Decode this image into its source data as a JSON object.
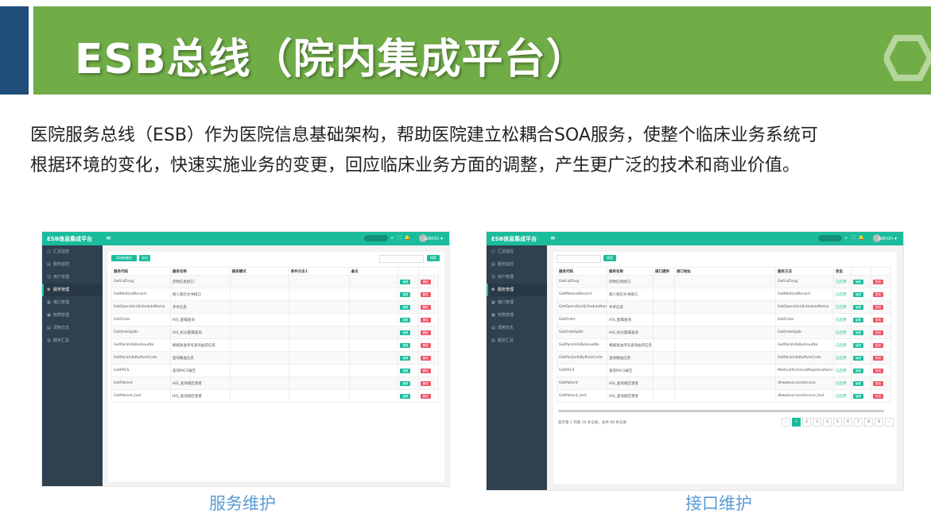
{
  "slide": {
    "title": "ESB总线（院内集成平台）",
    "intro_line1": "医院服务总线（ESB）作为医院信息基础架构，帮助医院建立松耦合SOA服务，使整个临床业务系统可",
    "intro_line2": "根据环境的变化，快速实施业务的变更，回应临床业务方面的调整，产生更广泛的技术和商业价值。",
    "caption_left": "服务维护",
    "caption_right": "接口维护",
    "colors": {
      "banner": "#70ad47",
      "tab": "#1f4e79",
      "caption": "#5b9bd5",
      "app_accent": "#1abc9c",
      "app_sidebar": "#2f4050",
      "delete": "#ed5565"
    }
  },
  "app": {
    "brand": "ESB信息集成平台",
    "menu_icon": "≡",
    "user": "admin",
    "sidebar": [
      "汇总监控",
      "服务监控",
      "用户管理",
      "服务管理",
      "接口管理",
      "权限管理",
      "调用日志",
      "服务汇总"
    ],
    "sidebar_icons": [
      "dashboard-icon",
      "monitor-icon",
      "user-icon",
      "gear-icon",
      "interface-icon",
      "permission-icon",
      "log-icon",
      "summary-icon"
    ]
  },
  "service": {
    "add_btn": "添加新服务",
    "export_btn": "导出",
    "search_btn": "搜索",
    "columns": [
      "服务代码",
      "服务名称",
      "服务模式",
      "条件分支1",
      "备注"
    ],
    "edit": "编辑",
    "delete": "删除",
    "rows": [
      [
        "GetLisDrug",
        "药物信息接口"
      ],
      [
        "GetMedicalRecord",
        "病人病历文书接口"
      ],
      [
        "GetOperationScheduleName",
        "手术信息"
      ],
      [
        "GetOrder",
        "HIS_医嘱查询"
      ],
      [
        "GetOrdeSplitr",
        "HIS_拆分医嘱查询"
      ],
      [
        "GetPackInfoByIssueNo",
        "根据发血单号查询血袋信息"
      ],
      [
        "GetPackInfoByPackCode",
        "查询输血信息"
      ],
      [
        "GetPACS",
        "查询PACS报告"
      ],
      [
        "GetPatient",
        "HIS_查询病区患者"
      ],
      [
        "GetPatient_test",
        "HIS_查询病区患者"
      ]
    ]
  },
  "interface": {
    "search_btn": "搜索",
    "columns": [
      "服务代码",
      "服务名称",
      "接口提供",
      "接口地址",
      "服务方法",
      "状态"
    ],
    "edit": "编辑",
    "delete": "禁用",
    "status": "已启用",
    "rows": [
      [
        "GetLisDrug",
        "药物信息接口",
        "GetLisDrug"
      ],
      [
        "GetMedicalRecord",
        "病人病历文书接口",
        "GetMedicalRecord"
      ],
      [
        "GetOperationScheduleName",
        "手术信息",
        "GetOperationScheduleName"
      ],
      [
        "GetOrder",
        "HIS_医嘱查询",
        "GetOrder"
      ],
      [
        "GetOrdeSplitr",
        "HIS_拆分医嘱查询",
        "GetOrdeSplitr"
      ],
      [
        "GetPackInfoByIssueNo",
        "根据发血单号查询血袋信息",
        "GetPackInfoByIssueNo"
      ],
      [
        "GetPackInfoByPackCode",
        "查询输血信息",
        "GetPackInfoByPackCode"
      ],
      [
        "GetPACS",
        "查询PACS报告",
        "MedicalTechnicalReportcalService"
      ],
      [
        "GetPatient",
        "HIS_查询病区患者",
        "dhwebserviceService"
      ],
      [
        "GetPatient_test",
        "HIS_查询病区患者",
        "dhwebserviceService_test"
      ]
    ],
    "page_info": "显示第 1 到第 10 条记录，总共 90 条记录",
    "pages": [
      "‹",
      "1",
      "2",
      "3",
      "4",
      "5",
      "6",
      "7",
      "8",
      "9",
      "›"
    ]
  }
}
